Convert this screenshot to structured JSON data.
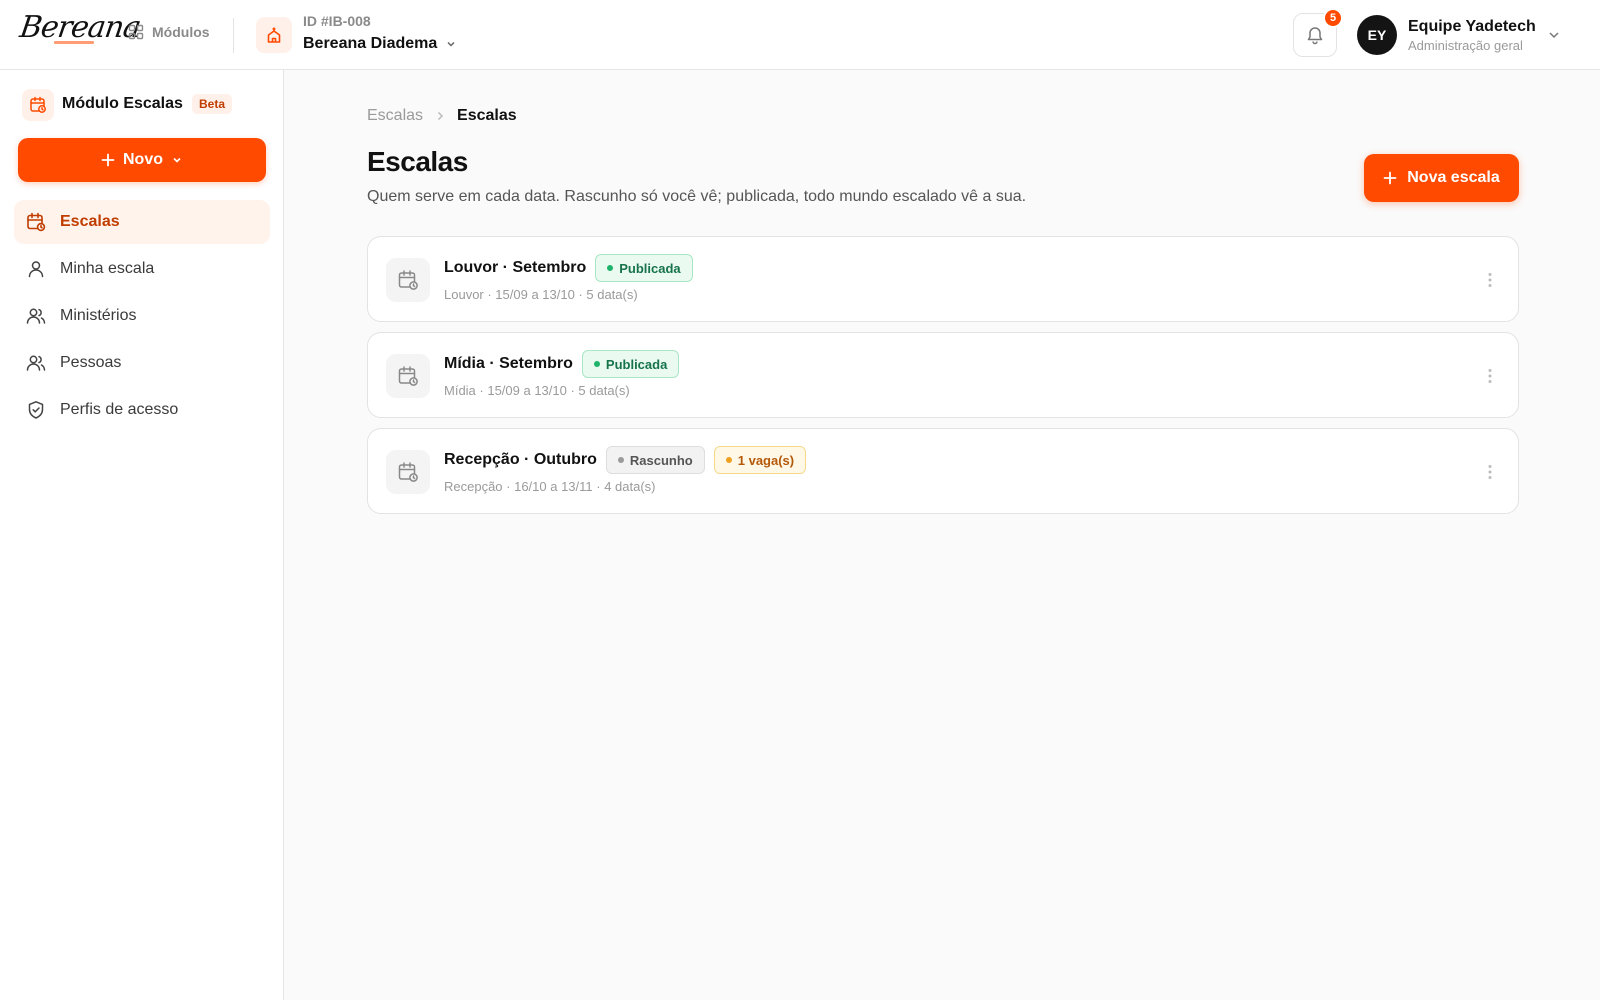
{
  "header": {
    "logo_text": "Bereana",
    "modules_label": "Módulos",
    "church_id": "ID #IB-008",
    "church_name": "Bereana Diadema",
    "notifications_count": "5",
    "user_initials": "EY",
    "user_name": "Equipe Yadetech",
    "user_role": "Administração geral"
  },
  "sidebar": {
    "module_title": "Módulo Escalas",
    "beta_label": "Beta",
    "novo_label": "Novo",
    "items": [
      {
        "label": "Escalas",
        "icon": "calendar-clock-icon",
        "active": true
      },
      {
        "label": "Minha escala",
        "icon": "user-icon",
        "active": false
      },
      {
        "label": "Ministérios",
        "icon": "users-icon",
        "active": false
      },
      {
        "label": "Pessoas",
        "icon": "users-icon",
        "active": false
      },
      {
        "label": "Perfis de acesso",
        "icon": "shield-check-icon",
        "active": false
      }
    ]
  },
  "main": {
    "breadcrumb": [
      "Escalas",
      "Escalas"
    ],
    "title": "Escalas",
    "description": "Quem serve em cada data. Rascunho só você vê; publicada, todo mundo escalado vê a sua.",
    "new_button": "Nova escala",
    "cards": [
      {
        "title": "Louvor · Setembro",
        "status": "Publicada",
        "extra": "",
        "meta": "Louvor · 15/09 a 13/10 · 5 data(s)"
      },
      {
        "title": "Mídia · Setembro",
        "status": "Publicada",
        "extra": "",
        "meta": "Mídia · 15/09 a 13/10 · 5 data(s)"
      },
      {
        "title": "Recepção · Outubro",
        "status": "Rascunho",
        "extra": "1 vaga(s)",
        "meta": "Recepção · 16/10 a 13/11 · 4 data(s)"
      }
    ]
  },
  "colors": {
    "accent": "#ff4a00",
    "accent_soft": "#fff3ec",
    "published": "#1eb36a",
    "warning": "#f0a020"
  }
}
